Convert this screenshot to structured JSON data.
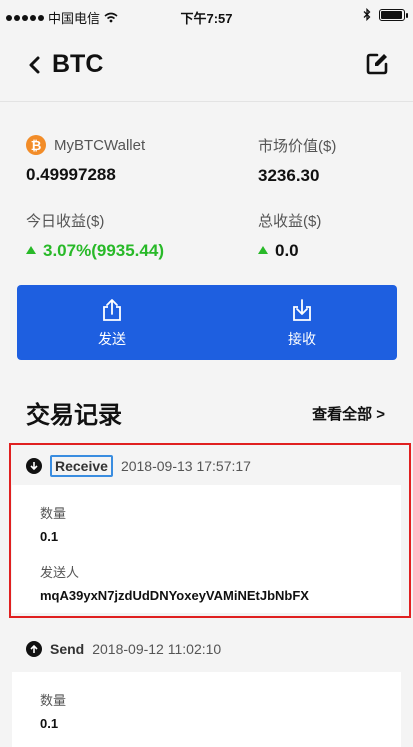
{
  "status": {
    "carrier": "中国电信",
    "time": "下午7:57",
    "battery_level": 0.95
  },
  "nav": {
    "title": "BTC"
  },
  "summary": {
    "wallet_name": "MyBTCWallet",
    "balance": "0.49997288",
    "market_value_label": "市场价值($)",
    "market_value": "3236.30",
    "today_label": "今日收益($)",
    "today_value": "3.07%(9935.44)",
    "total_label": "总收益($)",
    "total_value": "0.0"
  },
  "actions": {
    "send_label": "发送",
    "receive_label": "接收"
  },
  "history": {
    "title": "交易记录",
    "view_all": "查看全部 >"
  },
  "transactions": [
    {
      "type": "Receive",
      "datetime": "2018-09-13 17:57:17",
      "amount_label": "数量",
      "amount": "0.1",
      "sender_label": "发送人",
      "sender": "mqA39yxN7jzdUdDNYoxeyVAMiNEtJbNbFX"
    },
    {
      "type": "Send",
      "datetime": "2018-09-12 11:02:10",
      "amount_label": "数量",
      "amount": "0.1"
    }
  ],
  "colors": {
    "accent": "#1e5fe0",
    "positive": "#28b928",
    "bitcoin": "#f28c28",
    "highlight": "#e02020"
  }
}
